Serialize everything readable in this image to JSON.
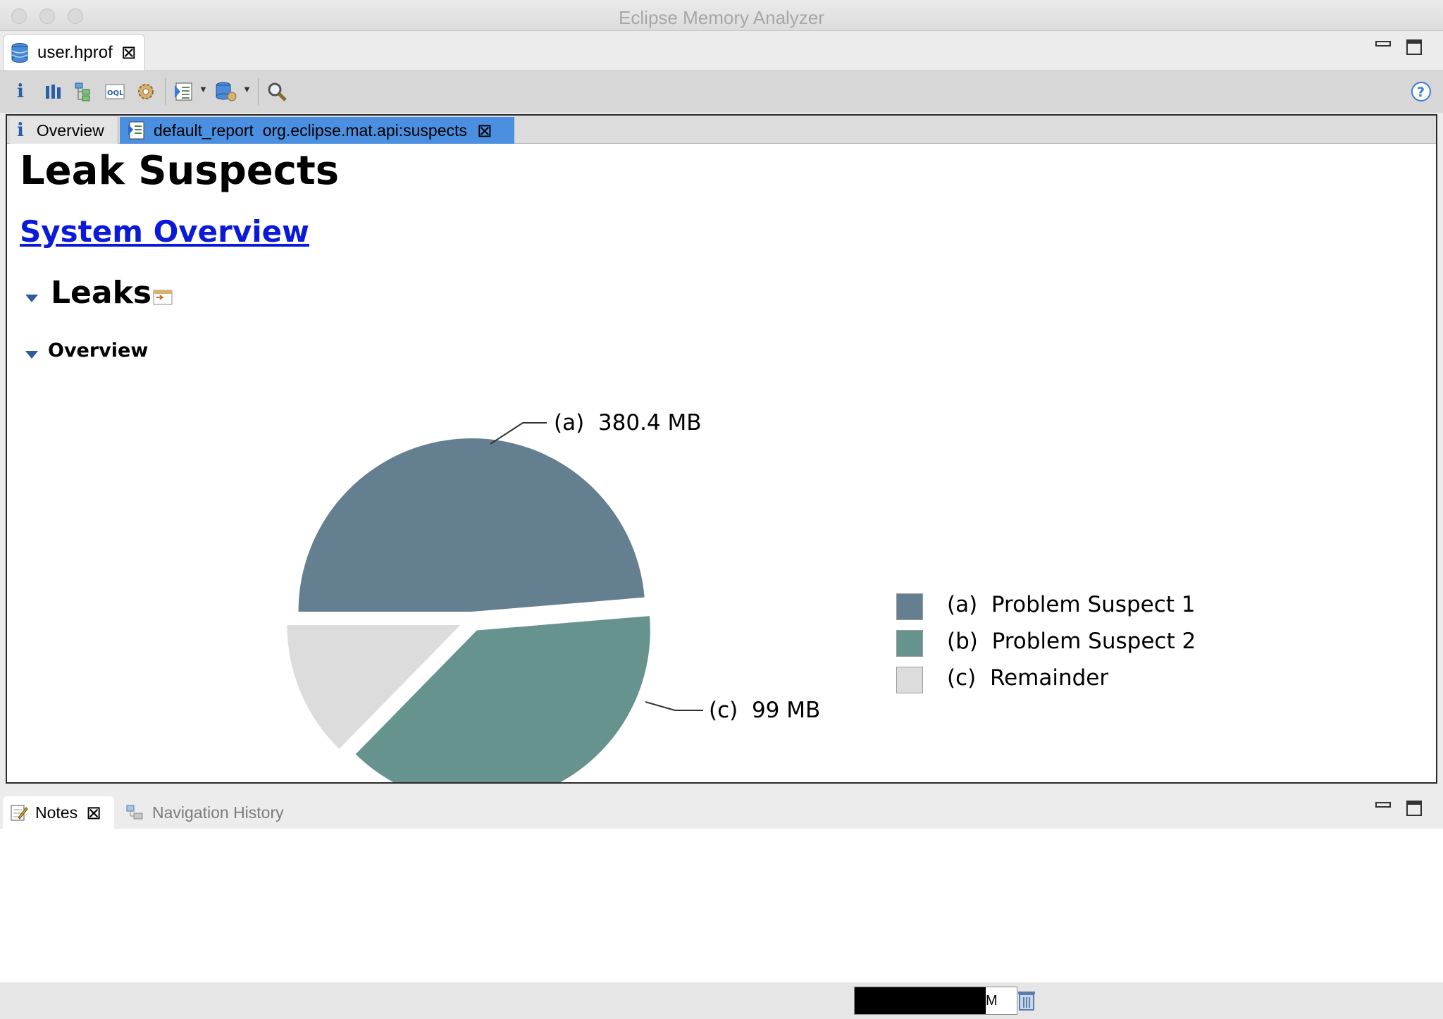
{
  "window": {
    "title": "Eclipse Memory Analyzer"
  },
  "editor_tab": {
    "label": "user.hprof",
    "icon": "database-icon"
  },
  "toolbar": {
    "icons": [
      "info-icon",
      "histogram-icon",
      "dominator-tree-icon",
      "oql-icon",
      "thread-overview-icon",
      "run-report-icon",
      "query-browser-icon",
      "find-object-icon",
      "help-icon"
    ]
  },
  "inner_tabs": [
    {
      "label": "Overview",
      "icon": "info-icon"
    },
    {
      "label": "default_report  org.eclipse.mat.api:suspects",
      "icon": "report-icon"
    }
  ],
  "report": {
    "title": "Leak Suspects",
    "system_overview_link": "System Overview",
    "leaks_heading": "Leaks",
    "overview_heading": "Overview"
  },
  "chart_data": {
    "type": "pie",
    "categories": [
      "(a)  Problem Suspect 1",
      "(b)  Problem Suspect 2",
      "(c)  Remainder"
    ],
    "values": [
      380.4,
      302,
      99
    ],
    "slice_labels": [
      "(a)  380.4 MB",
      "",
      "(c)  99 MB"
    ],
    "units": "MB",
    "exploded": true,
    "colors": [
      "#647f8f",
      "#67938f",
      "#dcdcdc"
    ],
    "legend_position": "right"
  },
  "bottom_tabs": [
    {
      "label": "Notes",
      "icon": "notes-icon",
      "active": true
    },
    {
      "label": "Navigation History",
      "icon": "navigation-history-icon",
      "active": false
    }
  ],
  "status": {
    "heap_text": "M"
  }
}
